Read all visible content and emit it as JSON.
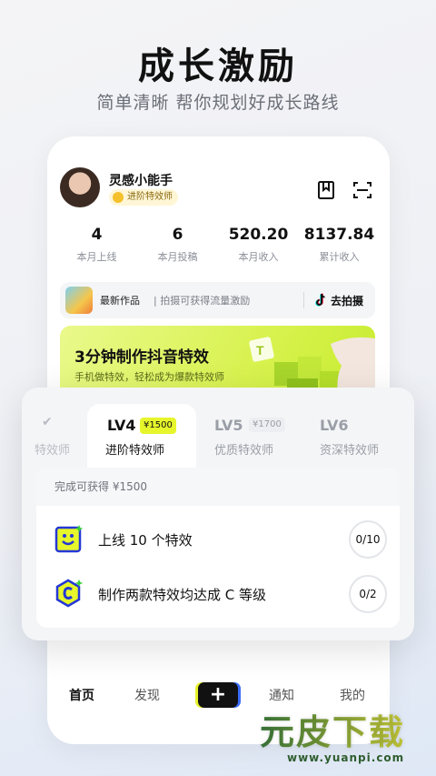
{
  "hero": {
    "title": "成长激励",
    "subtitle": "简单清晰 帮你规划好成长路线"
  },
  "profile": {
    "name": "灵感小能手",
    "badge": "进阶特效师"
  },
  "stats": [
    {
      "value": "4",
      "label": "本月上线"
    },
    {
      "value": "6",
      "label": "本月投稿"
    },
    {
      "value": "520.20",
      "label": "本月收入"
    },
    {
      "value": "8137.84",
      "label": "累计收入"
    }
  ],
  "work_bar": {
    "label": "最新作品",
    "hint": "| 拍摄可获得流量激励",
    "shoot_label": "去拍摄"
  },
  "banner": {
    "title": "3分钟制作抖音特效",
    "subtitle": "手机做特效，轻松成为爆款特效师"
  },
  "levels": {
    "done_title": "特效师",
    "active": {
      "name": "LV4",
      "price": "¥1500",
      "title": "进阶特效师"
    },
    "lv5": {
      "name": "LV5",
      "price": "¥1700",
      "title": "优质特效师"
    },
    "lv6": {
      "name": "LV6",
      "title": "资深特效师"
    }
  },
  "tasks": {
    "header": "完成可获得 ¥1500",
    "items": [
      {
        "label": "上线 10 个特效",
        "progress": "0/10"
      },
      {
        "label": "制作两款特效均达成 C 等级",
        "progress": "0/2"
      }
    ]
  },
  "nav": {
    "home": "首页",
    "discover": "发现",
    "plus": "+",
    "notice": "通知",
    "mine": "我的"
  },
  "watermark": {
    "main": "元皮下载",
    "sub": "www.yuanpi.com"
  },
  "colors": {
    "accent_yellow": "#e6f62b",
    "banner_green": "#d8f24e",
    "brand_blue": "#3b6cf6"
  }
}
